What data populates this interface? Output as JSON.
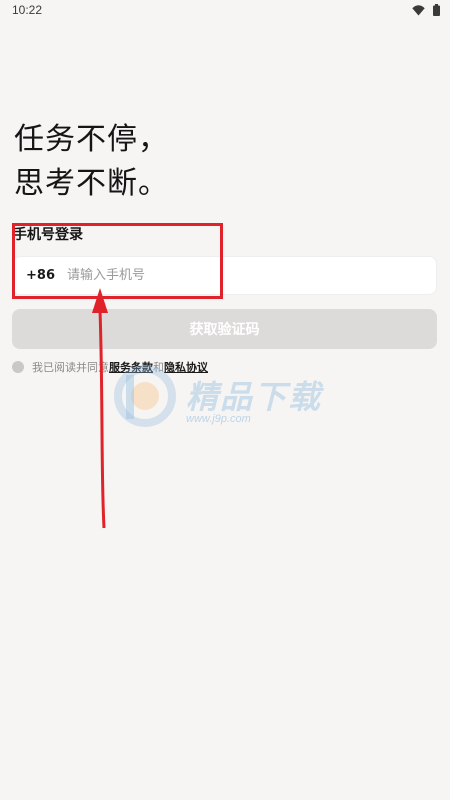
{
  "status_bar": {
    "time": "10:22",
    "icons": [
      "wifi-icon",
      "battery-icon"
    ]
  },
  "slogan": {
    "line1": "任务不停，",
    "line2": "思考不断。"
  },
  "login": {
    "title": "手机号登录",
    "country_code": "+86",
    "phone_placeholder": "请输入手机号",
    "phone_value": "",
    "get_code_label": "获取验证码"
  },
  "agreement": {
    "prefix": "我已阅读并同意",
    "service_terms": "服务条款",
    "and": "和",
    "privacy_policy": "隐私协议"
  },
  "watermark": {
    "title": "精品下载",
    "url": "www.j9p.com"
  },
  "colors": {
    "background": "#f6f5f3",
    "button_disabled": "#dcdbd9",
    "annotation_red": "#e0222a"
  }
}
